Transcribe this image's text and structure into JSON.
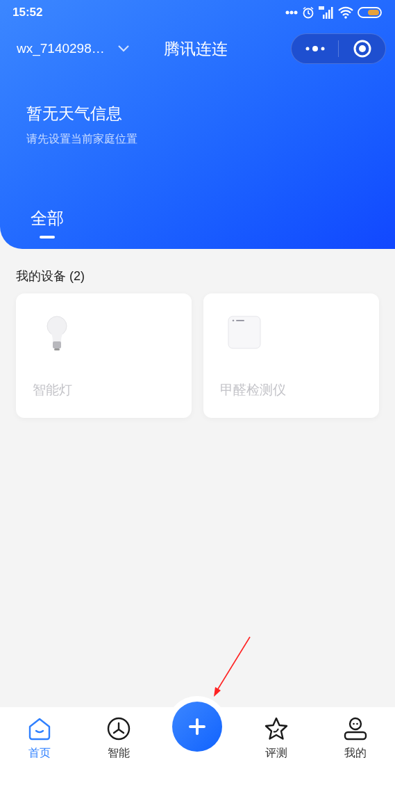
{
  "status_bar": {
    "time": "15:52"
  },
  "header": {
    "account": "wx_7140298…",
    "title": "腾讯连连"
  },
  "weather": {
    "title": "暂无天气信息",
    "hint": "请先设置当前家庭位置"
  },
  "tabs": [
    {
      "label": "全部",
      "selected": true
    }
  ],
  "devices_section": {
    "title": "我的设备 (2)",
    "devices": [
      {
        "name": "智能灯",
        "kind": "bulb"
      },
      {
        "name": "甲醛检测仪",
        "kind": "box"
      }
    ]
  },
  "bottom_nav": [
    {
      "label": "首页",
      "kind": "home",
      "selected": true
    },
    {
      "label": "智能",
      "kind": "smart",
      "selected": false
    },
    {
      "kind": "add"
    },
    {
      "label": "评测",
      "kind": "review",
      "selected": false
    },
    {
      "label": "我的",
      "kind": "me",
      "selected": false
    }
  ]
}
